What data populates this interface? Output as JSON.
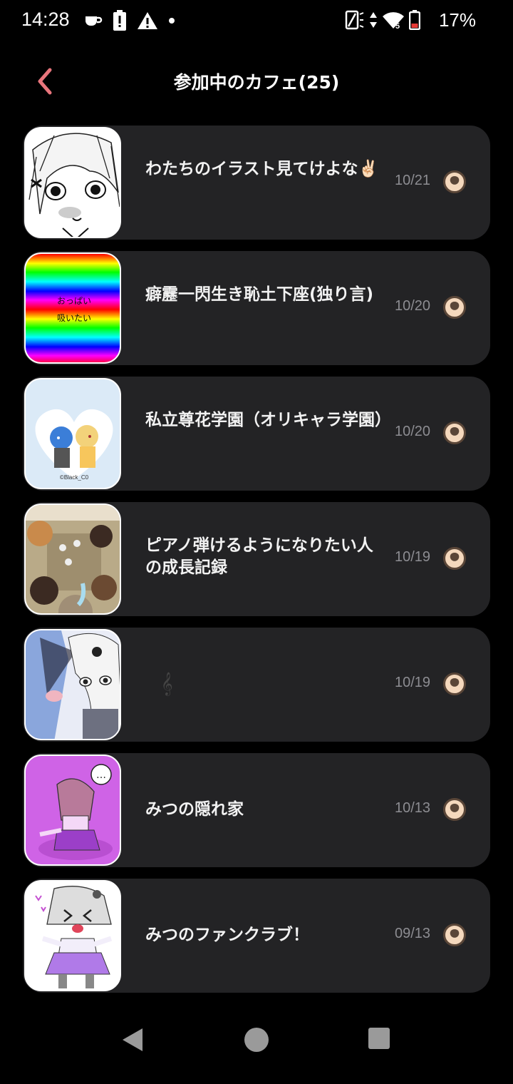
{
  "status_bar": {
    "time": "14:28",
    "battery": "17%",
    "left_icons": [
      "coffee-icon",
      "alert-battery-icon",
      "warning-icon",
      "dot-icon"
    ],
    "right_icons": [
      "no-sim-icon",
      "data-arrows-icon",
      "wifi-icon",
      "battery-low-icon"
    ]
  },
  "header": {
    "title": "参加中のカフェ(25)",
    "accent_color": "#e8757c"
  },
  "cafes": [
    {
      "name": "わたちのイラスト見てけよな✌🏻",
      "date": "10/21",
      "thumb": "manga-girl"
    },
    {
      "name": "癖靂一閃生き恥土下座(独り言)",
      "date": "10/20",
      "thumb": "rainbow",
      "thumb_text": [
        "おっぱい",
        "吸いたい"
      ]
    },
    {
      "name": "私立尊花学園（オリキャラ学園）",
      "date": "10/20",
      "thumb": "heart-duo",
      "thumb_text": [
        "©Black_C0"
      ]
    },
    {
      "name": "ピアノ弾けるようになりたい人の成長記録",
      "date": "10/19",
      "thumb": "boys-table"
    },
    {
      "name": "",
      "date": "10/19",
      "thumb": "blue-girls",
      "icon": "treble-clef-icon"
    },
    {
      "name": "みつの隠れ家",
      "date": "10/13",
      "thumb": "purple-chibi",
      "thumb_text": [
        "…"
      ]
    },
    {
      "name": "みつのファンクラブ！",
      "date": "09/13",
      "thumb": "purple-girl"
    }
  ],
  "nav": [
    "back-triangle",
    "home-circle",
    "recents-square"
  ]
}
